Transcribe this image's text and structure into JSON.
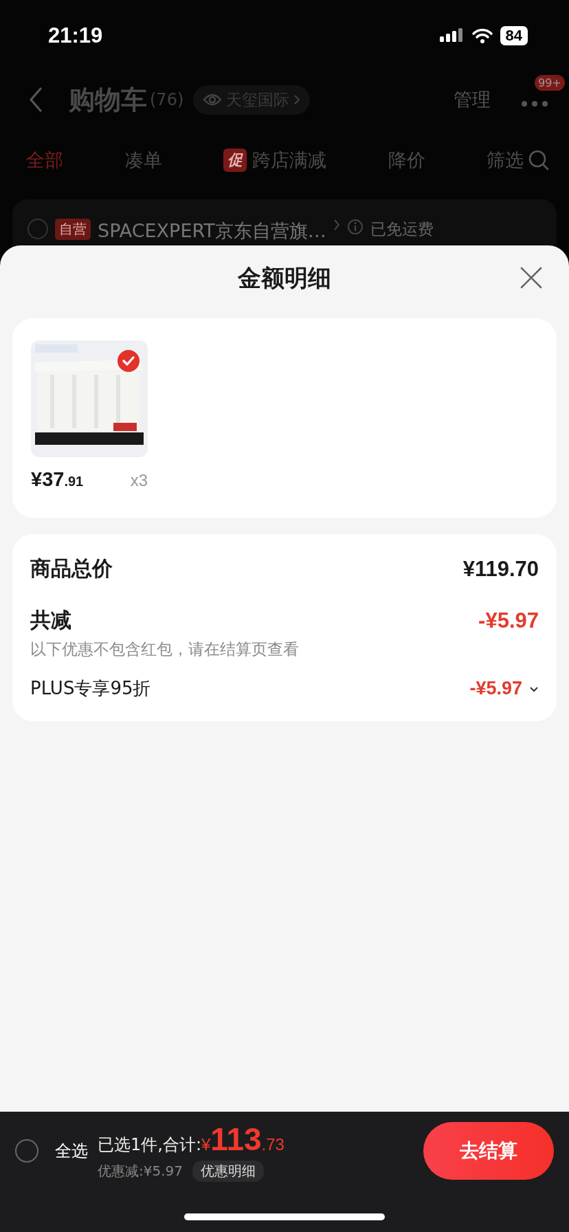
{
  "status_bar": {
    "time": "21:19",
    "battery": "84"
  },
  "header": {
    "title": "购物车",
    "count": "(76)",
    "address": "天玺国际",
    "manage": "管理",
    "badge": "99+"
  },
  "tabs": [
    {
      "label": "全部",
      "selected": true
    },
    {
      "label": "凑单",
      "selected": false
    },
    {
      "label": "跨店满减",
      "selected": false,
      "tag": "促"
    },
    {
      "label": "降价",
      "selected": false
    }
  ],
  "filter": "筛选",
  "store": {
    "checked": false,
    "tag": "自营",
    "name": "SPACEXPERT京东自营旗…",
    "shipping": "已免运费"
  },
  "sheet": {
    "title": "金额明细",
    "items": [
      {
        "kind": "picture",
        "selected": true,
        "price_main": "¥37",
        "price_decimal": ".91",
        "quantity": "x3"
      }
    ],
    "summary": {
      "total_label": "商品总价",
      "total_value": "¥119.70",
      "discount_label": "共减",
      "discount_value": "-¥5.97",
      "note": "以下优惠不包含红包，请在结算页查看",
      "discounts": [
        {
          "label": "PLUS专享95折",
          "value": "-¥5.97",
          "expanded": false
        }
      ]
    }
  },
  "bottom_bar": {
    "select_all": {
      "label": "全选",
      "checked": false
    },
    "selected_text": "已选1件,合计:",
    "currency": "¥",
    "total_main": "113",
    "total_decimal": ".73",
    "saving": "优惠减:¥5.97",
    "detail_button": "优惠明细",
    "checkout_button": "去结算"
  }
}
